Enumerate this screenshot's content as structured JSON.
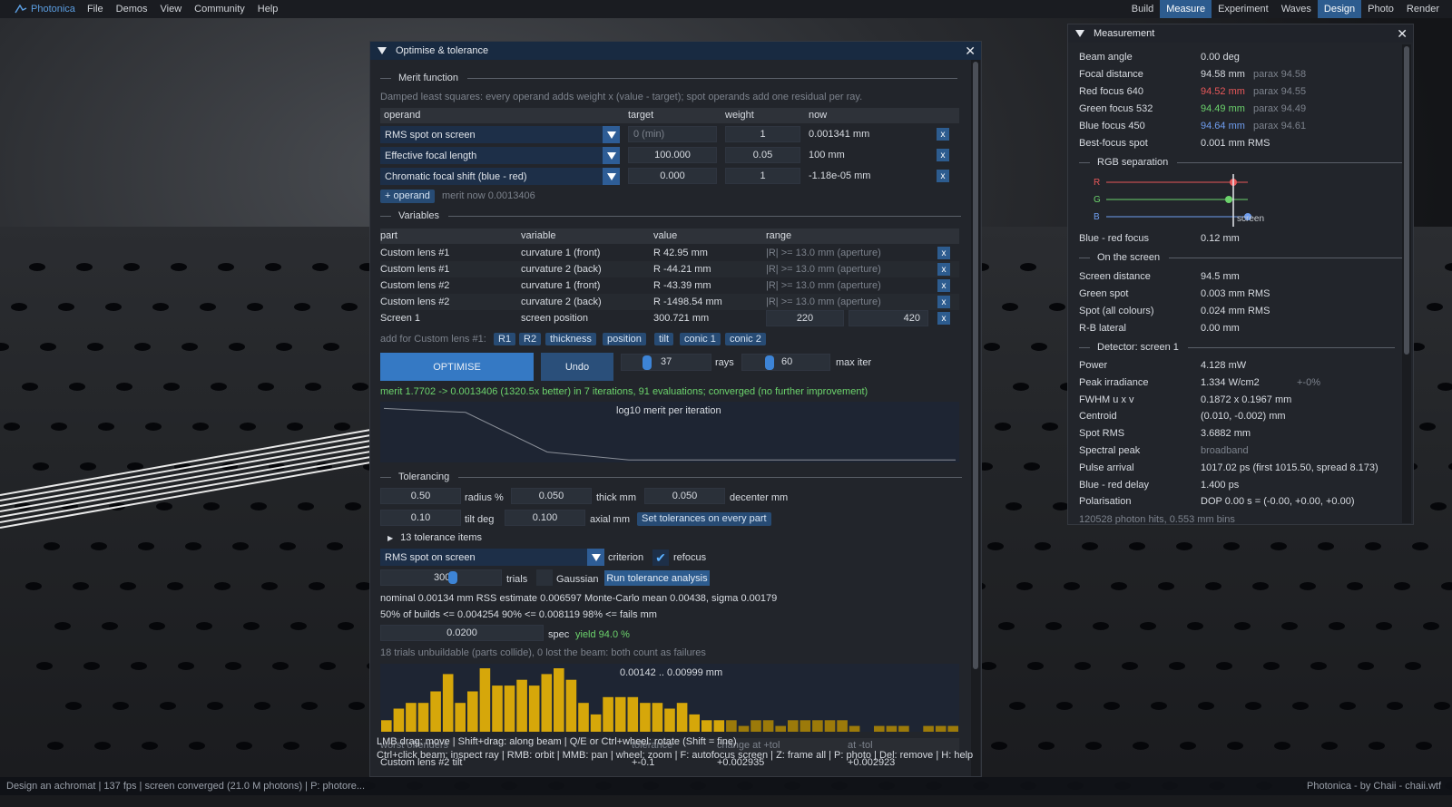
{
  "menubar": {
    "app": "Photonica",
    "items": [
      "File",
      "Demos",
      "View",
      "Community",
      "Help"
    ],
    "right": [
      "Build",
      "Measure",
      "Experiment",
      "Waves",
      "Design",
      "Photo",
      "Render"
    ],
    "active": [
      "Measure",
      "Design"
    ]
  },
  "optimise": {
    "title": "Optimise & tolerance",
    "merit_section": "Merit function",
    "merit_desc": "Damped least squares: every operand adds weight x (value - target); spot operands add one residual per ray.",
    "merit_cols": [
      "operand",
      "target",
      "weight",
      "now"
    ],
    "operands": [
      {
        "operand": "RMS spot on screen",
        "target": "0 (min)",
        "weight": "1",
        "now": "0.001341 mm"
      },
      {
        "operand": "Effective focal length",
        "target": "100.000",
        "weight": "0.05",
        "now": "100 mm"
      },
      {
        "operand": "Chromatic focal shift (blue - red)",
        "target": "0.000",
        "weight": "1",
        "now": "-1.18e-05 mm"
      }
    ],
    "add_operand": "+ operand",
    "merit_now": "merit now 0.0013406",
    "variables_section": "Variables",
    "var_cols": [
      "part",
      "variable",
      "value",
      "range"
    ],
    "variables": [
      {
        "part": "Custom lens #1",
        "variable": "curvature 1 (front)",
        "value": "R 42.95 mm",
        "range": "|R| >= 13.0 mm (aperture)"
      },
      {
        "part": "Custom lens #1",
        "variable": "curvature 2 (back)",
        "value": "R -44.21 mm",
        "range": "|R| >= 13.0 mm (aperture)"
      },
      {
        "part": "Custom lens #2",
        "variable": "curvature 1 (front)",
        "value": "R -43.39 mm",
        "range": "|R| >= 13.0 mm (aperture)"
      },
      {
        "part": "Custom lens #2",
        "variable": "curvature 2 (back)",
        "value": "R -1498.54 mm",
        "range": "|R| >= 13.0 mm (aperture)"
      }
    ],
    "screen_var": {
      "part": "Screen 1",
      "variable": "screen position",
      "value": "300.721 mm",
      "min": "220",
      "max": "420"
    },
    "add_for": "add for Custom lens #1:",
    "add_chips": [
      "R1",
      "R2",
      "thickness",
      "position",
      "tilt",
      "conic 1",
      "conic 2"
    ],
    "optimise_btn": "OPTIMISE",
    "undo_btn": "Undo",
    "rays": "37",
    "rays_label": "rays",
    "max_iter": "60",
    "max_iter_label": "max iter",
    "result": "merit 1.7702 -> 0.0013406  (1320.5x better) in 7 iterations, 91 evaluations; converged (no further improvement)",
    "plot_title": "log10 merit per iteration",
    "plot_points": [
      0.25,
      0.0,
      -2.5,
      -3.0,
      -3.0,
      -3.0,
      -3.0,
      -3.0
    ],
    "tol_section": "Tolerancing",
    "tol_fields": [
      {
        "value": "0.50",
        "label": "radius %"
      },
      {
        "value": "0.050",
        "label": "thick mm"
      },
      {
        "value": "0.050",
        "label": "decenter mm"
      },
      {
        "value": "0.10",
        "label": "tilt deg"
      },
      {
        "value": "0.100",
        "label": "axial mm"
      }
    ],
    "set_tol_btn": "Set tolerances on every part",
    "tol_items": "13 tolerance items",
    "criterion_value": "RMS spot on screen",
    "criterion_label": "criterion",
    "refocus_label": "refocus",
    "trials": "300",
    "trials_label": "trials",
    "gaussian_label": "Gaussian",
    "run_btn": "Run tolerance analysis",
    "stats1": "nominal 0.00134 mm   RSS estimate 0.006597   Monte-Carlo mean 0.00438, sigma 0.00179",
    "stats2": "50% of builds <= 0.004254   90% <= 0.008119   98% <= fails mm",
    "spec_value": "0.0200",
    "spec_label": "spec",
    "yield": "yield 94.0 %",
    "unbuildable": "18 trials unbuildable (parts collide), 0 lost the beam: both count as failures",
    "hist_range": "0.00142 .. 0.00999 mm",
    "hist_values": [
      2,
      4,
      5,
      5,
      7,
      10,
      5,
      7,
      11,
      8,
      8,
      9,
      8,
      10,
      11,
      9,
      5,
      3,
      6,
      6,
      6,
      5,
      5,
      4,
      5,
      3,
      2,
      2,
      2,
      1,
      2,
      2,
      1,
      2,
      2,
      2,
      2,
      2,
      1,
      0,
      1,
      1,
      1,
      0,
      1,
      1,
      1
    ],
    "offenders_cols": [
      "worst offenders",
      "tolerance",
      "change at +tol",
      "at -tol"
    ],
    "offenders": [
      {
        "name": "Custom lens #2 tilt",
        "tol": "+-0.1",
        "plus": "+0.002935",
        "minus": "+0.002923"
      }
    ]
  },
  "measurement": {
    "title": "Measurement",
    "rows1": [
      {
        "k": "Beam angle",
        "v": "0.00 deg",
        "p": "",
        "color": "#d8dce2"
      },
      {
        "k": "Focal distance",
        "v": "94.58 mm",
        "p": "parax 94.58",
        "color": "#d8dce2"
      },
      {
        "k": "Red focus 640",
        "v": "94.52 mm",
        "p": "parax 94.55",
        "color": "#e8585a"
      },
      {
        "k": "Green focus 532",
        "v": "94.49 mm",
        "p": "parax 94.49",
        "color": "#6cd36c"
      },
      {
        "k": "Blue focus 450",
        "v": "94.64 mm",
        "p": "parax 94.61",
        "color": "#6f9ef0"
      },
      {
        "k": "Best-focus spot",
        "v": "0.001 mm RMS",
        "p": "",
        "color": "#d8dce2"
      }
    ],
    "rgb_section": "RGB separation",
    "rgb_labels": [
      "R",
      "G",
      "B"
    ],
    "rgb_colors": [
      "#e8585a",
      "#6cd36c",
      "#6f9ef0"
    ],
    "screen_label": "screen",
    "blue_red": {
      "k": "Blue - red focus",
      "v": "0.12 mm"
    },
    "screen_section": "On the screen",
    "rows2": [
      {
        "k": "Screen distance",
        "v": "94.5 mm"
      },
      {
        "k": "Green spot",
        "v": "0.003 mm RMS"
      },
      {
        "k": "Spot (all colours)",
        "v": "0.024 mm RMS"
      },
      {
        "k": "R-B lateral",
        "v": "0.00 mm"
      }
    ],
    "detector_section": "Detector: screen 1",
    "rows3": [
      {
        "k": "Power",
        "v": "4.128 mW",
        "p": ""
      },
      {
        "k": "Peak irradiance",
        "v": "1.334 W/cm2",
        "p": "+-0%"
      },
      {
        "k": "FWHM u x v",
        "v": "0.1872 x 0.1967 mm",
        "p": ""
      },
      {
        "k": "Centroid",
        "v": "(0.010, -0.002) mm",
        "p": ""
      },
      {
        "k": "Spot RMS",
        "v": "3.6882 mm",
        "p": ""
      },
      {
        "k": "Spectral peak",
        "v": "broadband",
        "p": ""
      },
      {
        "k": "Pulse arrival",
        "v": "1017.02 ps (first 1015.50, spread 8.173)",
        "p": ""
      },
      {
        "k": "Blue - red delay",
        "v": "1.400 ps",
        "p": ""
      },
      {
        "k": "Polarisation",
        "v": "DOP 0.00  s = (-0.00, +0.00, +0.00)",
        "p": ""
      }
    ],
    "footer": "120528 photon hits, 0.553 mm bins"
  },
  "hints": {
    "line1": "LMB drag: move  |  Shift+drag: along beam  |  Q/E or Ctrl+wheel: rotate (Shift = fine)",
    "line2": "Ctrl+click beam: inspect ray  |  RMB: orbit  |  MMB: pan  |  wheel: zoom  |  F: autofocus screen  |  Z: frame all  |  P: photo  |  Del: remove  |  H: help"
  },
  "status": {
    "left": "Design an achromat  |  137 fps  |  screen converged (21.0 M photons)  |  P: photore...",
    "right": "Photonica  -  by Chaii  -  chaii.wtf"
  }
}
